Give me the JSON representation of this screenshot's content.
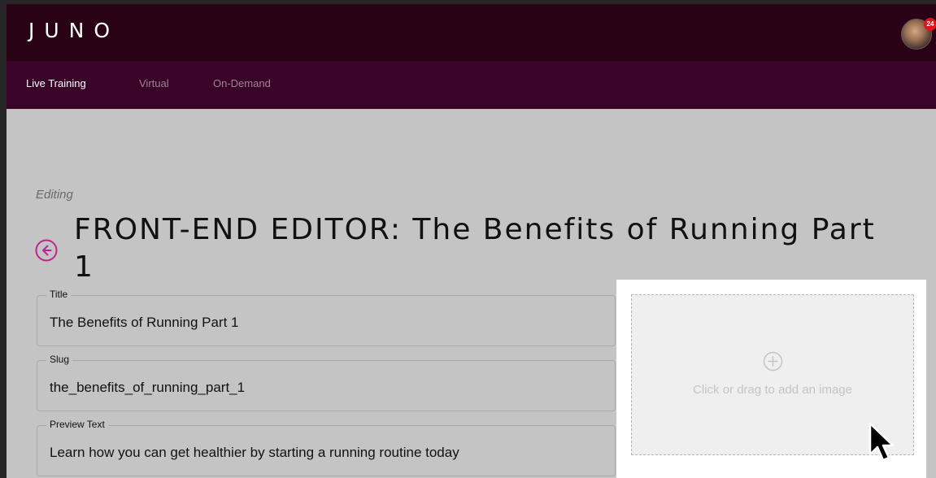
{
  "header": {
    "logo": "JUNO",
    "notification_count": "24"
  },
  "nav": {
    "items": [
      {
        "label": "Live Training",
        "active": true
      },
      {
        "label": "Virtual",
        "active": false
      },
      {
        "label": "On-Demand",
        "active": false
      }
    ]
  },
  "page": {
    "editing_label": "Editing",
    "title": "FRONT-END EDITOR: The Benefits of Running Part 1"
  },
  "form": {
    "title_label": "Title",
    "title_value": "The Benefits of Running Part 1",
    "slug_label": "Slug",
    "slug_value": "the_benefits_of_running_part_1",
    "preview_label": "Preview Text",
    "preview_value": "Learn how you can get healthier by starting a running routine today"
  },
  "image_upload": {
    "prompt": "Click or drag to add an image",
    "icon": "plus-circle-icon"
  },
  "icons": {
    "back": "arrow-left-circle-icon",
    "cursor": "mouse-pointer-icon"
  },
  "colors": {
    "topbar": "#290216",
    "subnav": "#3a0428",
    "accent": "#c0238f",
    "background": "#c4c4c4",
    "badge": "#e0141c"
  }
}
